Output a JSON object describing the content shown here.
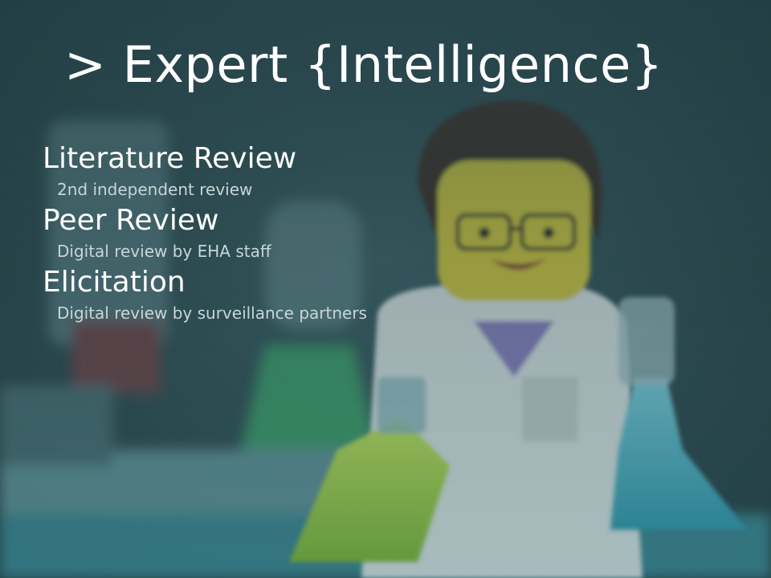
{
  "slide": {
    "title": "> Expert {Intelligence}",
    "items": [
      {
        "heading": "Literature Review",
        "sub": "2nd independent review"
      },
      {
        "heading": "Peer Review",
        "sub": "Digital review by EHA staff"
      },
      {
        "heading": "Elicitation",
        "sub": "Digital review by surveillance partners"
      }
    ]
  },
  "background": {
    "image": "lego-scientist-with-flasks",
    "dominant_color": "#2e4c52"
  }
}
